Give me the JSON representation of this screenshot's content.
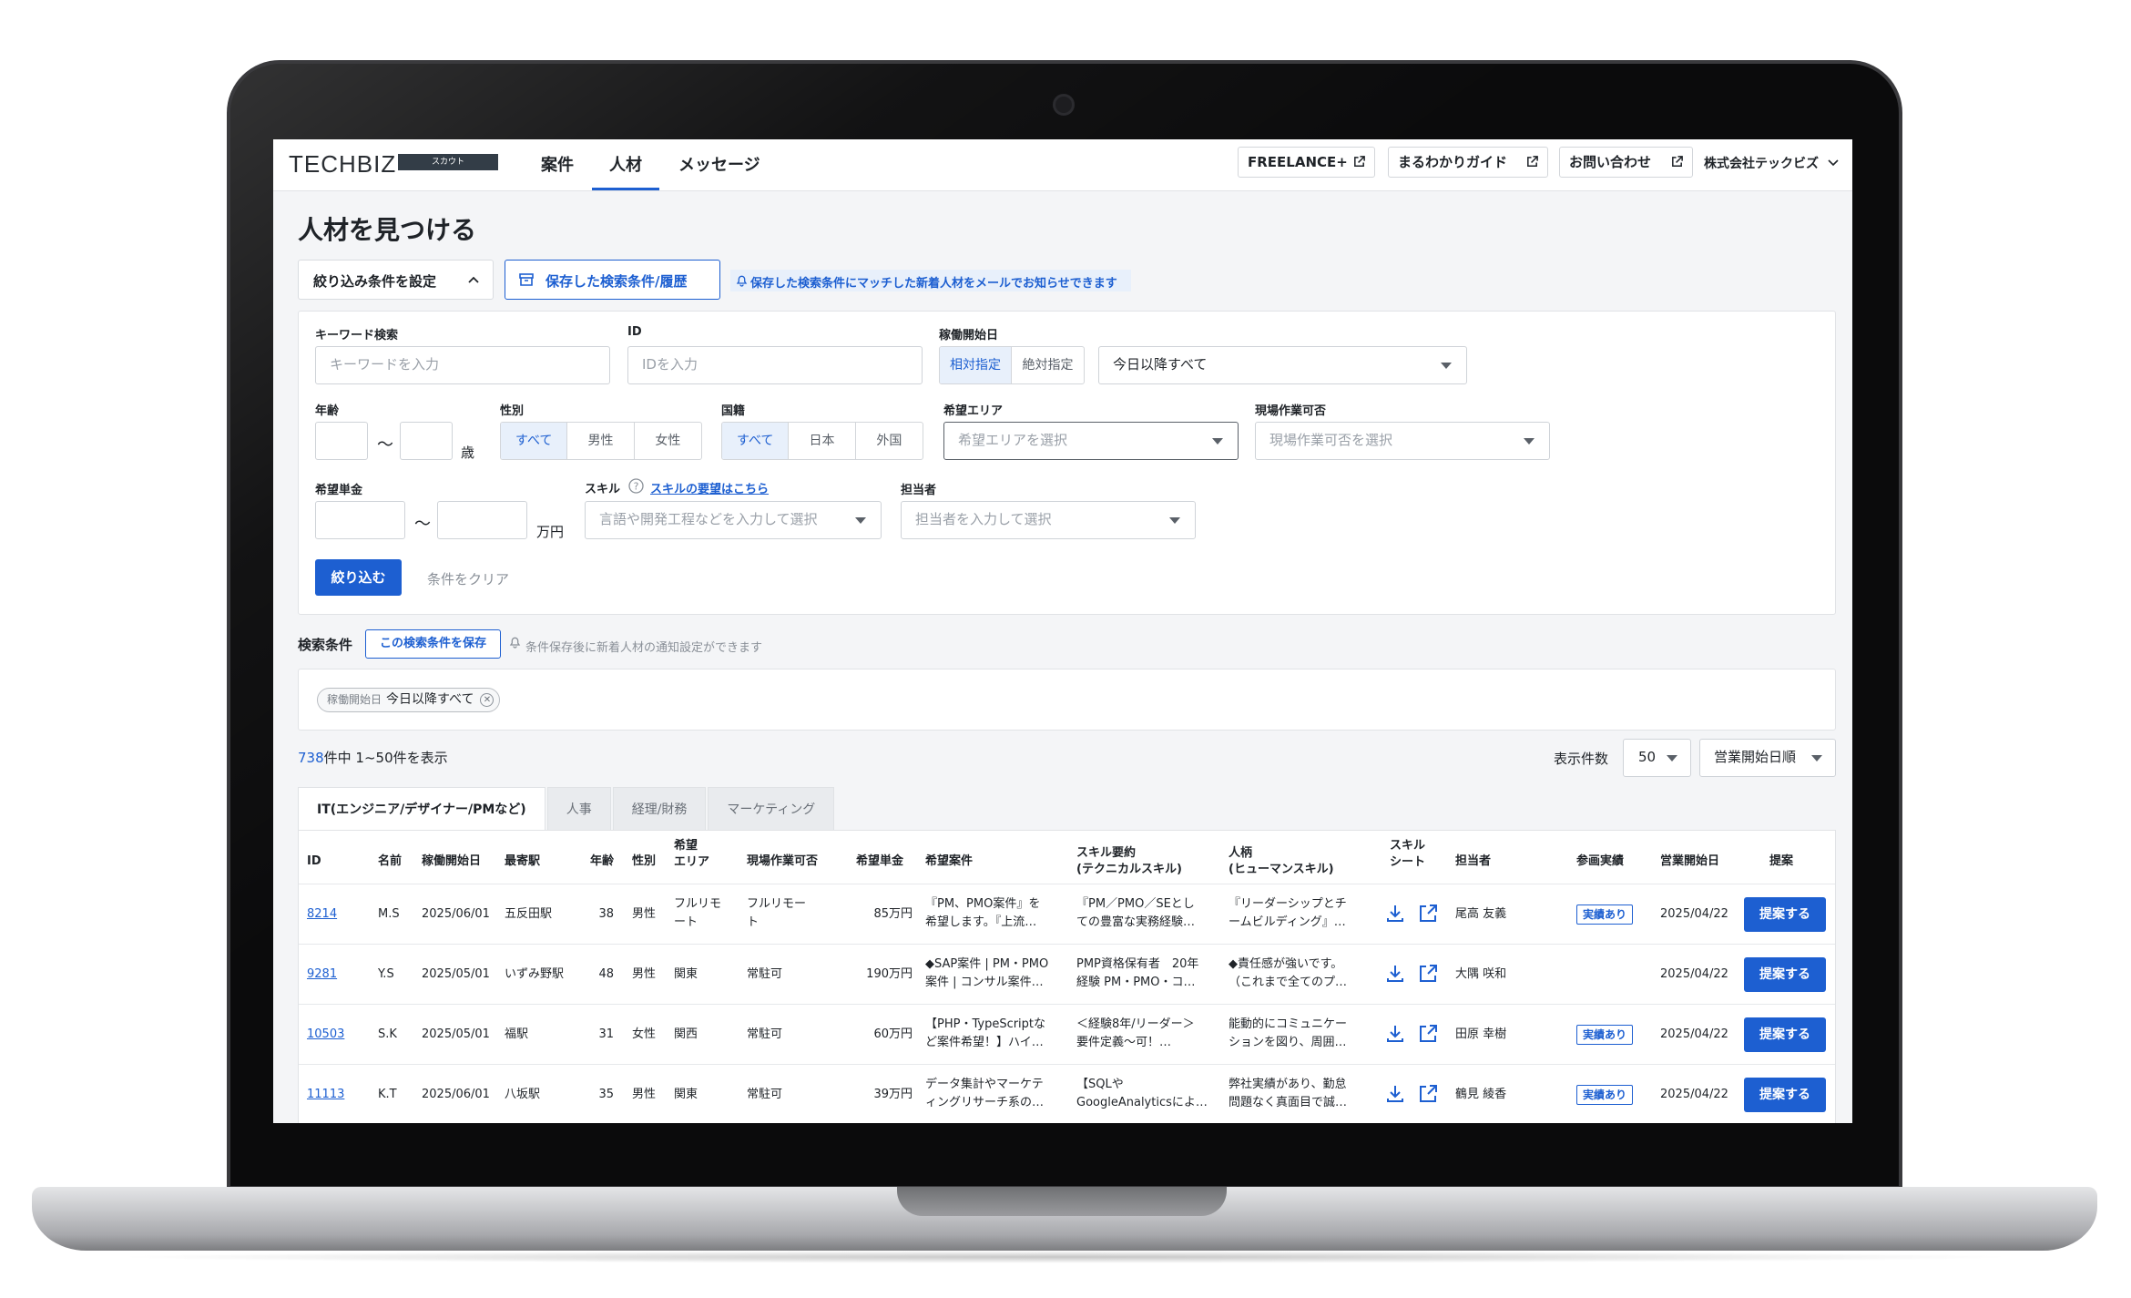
{
  "header": {
    "logo": "TECHBIZ",
    "logo_badge": "スカウト",
    "nav": [
      "案件",
      "人材",
      "メッセージ"
    ],
    "links": [
      "FREELANCE+",
      "まるわかりガイド",
      "お問い合わせ"
    ],
    "company": "株式会社テックビズ"
  },
  "page": {
    "title": "人材を見つける",
    "filter_toggle": "絞り込み条件を設定",
    "saved_button": "保存した検索条件/履歴",
    "saved_notice": "保存した検索条件にマッチした新着人材をメールでお知らせできます"
  },
  "filters": {
    "keyword": {
      "label": "キーワード検索",
      "placeholder": "キーワードを入力"
    },
    "id": {
      "label": "ID",
      "placeholder": "IDを入力"
    },
    "start": {
      "label": "稼働開始日",
      "modes": [
        "相対指定",
        "絶対指定"
      ],
      "value": "今日以降すべて"
    },
    "age": {
      "label": "年齢",
      "tilde": "〜",
      "unit": "歳"
    },
    "gender": {
      "label": "性別",
      "options": [
        "すべて",
        "男性",
        "女性"
      ]
    },
    "nationality": {
      "label": "国籍",
      "options": [
        "すべて",
        "日本",
        "外国"
      ]
    },
    "area": {
      "label": "希望エリア",
      "placeholder": "希望エリアを選択"
    },
    "onsite": {
      "label": "現場作業可否",
      "placeholder": "現場作業可否を選択"
    },
    "rate": {
      "label": "希望単金",
      "tilde": "〜",
      "unit": "万円"
    },
    "skill": {
      "label": "スキル",
      "help_link": "スキルの要望はこちら",
      "placeholder": "言語や開発工程などを入力して選択"
    },
    "owner": {
      "label": "担当者",
      "placeholder": "担当者を入力して選択"
    },
    "submit": "絞り込む",
    "clear": "条件をクリア"
  },
  "conditions": {
    "label": "検索条件",
    "save_button": "この検索条件を保存",
    "hint": "条件保存後に新着人材の通知設定ができます",
    "chip_key": "稼働開始日",
    "chip_value": "今日以降すべて"
  },
  "results": {
    "total": "738",
    "range": "件中 1~50件を表示",
    "per_page_label": "表示件数",
    "per_page": "50",
    "sort": "営業開始日順"
  },
  "tabs": [
    "IT(エンジニア/デザイナー/PMなど)",
    "人事",
    "経理/財務",
    "マーケティング"
  ],
  "columns": {
    "id": "ID",
    "name": "名前",
    "start": "稼働開始日",
    "station": "最寄駅",
    "age": "年齢",
    "gender": "性別",
    "area_1": "希望",
    "area_2": "エリア",
    "onsite": "現場作業可否",
    "rate": "希望単金",
    "project": "希望案件",
    "skill_1": "スキル要約",
    "skill_2": "(テクニカルスキル)",
    "person_1": "人柄",
    "person_2": "(ヒューマンスキル)",
    "sheet_1": "スキル",
    "sheet_2": "シート",
    "owner": "担当者",
    "record": "参画実績",
    "sales_date": "営業開始日",
    "propose": "提案"
  },
  "rows": [
    {
      "id": "8214",
      "name": "M.S",
      "start": "2025/06/01",
      "station": "五反田駅",
      "age": "38",
      "gender": "男性",
      "area_1": "フルリモ",
      "area_2": "ート",
      "onsite_1": "フルリモー",
      "onsite_2": "ト",
      "rate": "85万円",
      "project_1": "『PM、PMO案件』を",
      "project_2": "希望します。『上流…",
      "skill_1": "『PM／PMO／SEとし",
      "skill_2": "ての豊富な実務経験…",
      "person_1": "『リーダーシップとチ",
      "person_2": "ームビルディング』…",
      "owner": "尾高 友義",
      "record": "実績あり",
      "sales_date": "2025/04/22",
      "propose": "提案する"
    },
    {
      "id": "9281",
      "name": "Y.S",
      "start": "2025/05/01",
      "station": "いずみ野駅",
      "age": "48",
      "gender": "男性",
      "area_1": "関東",
      "area_2": "",
      "onsite_1": "常駐可",
      "onsite_2": "",
      "rate": "190万円",
      "project_1": "◆SAP案件 | PM・PMO",
      "project_2": "案件 | コンサル案件…",
      "skill_1": "PMP資格保有者　20年",
      "skill_2": "経験 PM・PMO・コ…",
      "person_1": "◆責任感が強いです。",
      "person_2": "（これまで全てのプ…",
      "owner": "大隅 咲和",
      "record": "",
      "sales_date": "2025/04/22",
      "propose": "提案する"
    },
    {
      "id": "10503",
      "name": "S.K",
      "start": "2025/05/01",
      "station": "福駅",
      "age": "31",
      "gender": "女性",
      "area_1": "関西",
      "area_2": "",
      "onsite_1": "常駐可",
      "onsite_2": "",
      "rate": "60万円",
      "project_1": "【PHP・TypeScriptな",
      "project_2": "ど案件希望！】ハイ…",
      "skill_1": "＜経験8年/リーダー＞",
      "skill_2": "要件定義〜可！…",
      "person_1": "能動的にコミュニケー",
      "person_2": "ションを図り、周囲…",
      "owner": "田原 幸樹",
      "record": "実績あり",
      "sales_date": "2025/04/22",
      "propose": "提案する"
    },
    {
      "id": "11113",
      "name": "K.T",
      "start": "2025/06/01",
      "station": "八坂駅",
      "age": "35",
      "gender": "男性",
      "area_1": "関東",
      "area_2": "",
      "onsite_1": "常駐可",
      "onsite_2": "",
      "rate": "39万円",
      "project_1": "データ集計やマーケテ",
      "project_2": "ィングリサーチ系の…",
      "skill_1": "【SQLや",
      "skill_2": "GoogleAnalyticsによ…",
      "person_1": "弊社実績があり、勤怠",
      "person_2": "問題なく真面目で誠…",
      "owner": "鶴見 綾香",
      "record": "実績あり",
      "sales_date": "2025/04/22",
      "propose": "提案する"
    }
  ],
  "colors": {
    "accent": "#1d5fd1",
    "accent_bg": "#e8f0fb",
    "frame": "#0b0b0c"
  }
}
